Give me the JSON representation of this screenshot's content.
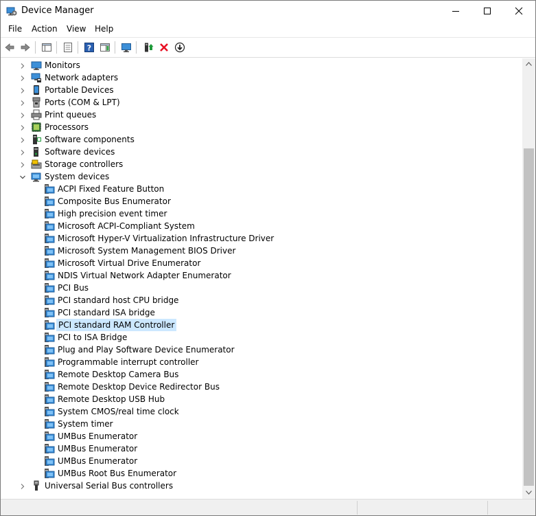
{
  "window": {
    "title": "Device Manager"
  },
  "menu": [
    "File",
    "Action",
    "View",
    "Help"
  ],
  "colors": {
    "selection": "#cce8ff",
    "accent": "#0078d7",
    "delete": "#e81123",
    "green": "#1e9a3a"
  },
  "toolbar_icons": [
    "back-icon",
    "forward-icon",
    "show-hide-tree-icon",
    "properties-icon",
    "help-icon",
    "action-pane-icon",
    "monitor-scan-icon",
    "update-driver-icon",
    "uninstall-icon",
    "download-icon"
  ],
  "tree": [
    {
      "label": "Monitors",
      "level": 0,
      "expanded": false,
      "icon": "monitor"
    },
    {
      "label": "Network adapters",
      "level": 0,
      "expanded": false,
      "icon": "network"
    },
    {
      "label": "Portable Devices",
      "level": 0,
      "expanded": false,
      "icon": "portable"
    },
    {
      "label": "Ports (COM & LPT)",
      "level": 0,
      "expanded": false,
      "icon": "port"
    },
    {
      "label": "Print queues",
      "level": 0,
      "expanded": false,
      "icon": "printer"
    },
    {
      "label": "Processors",
      "level": 0,
      "expanded": false,
      "icon": "chip"
    },
    {
      "label": "Software components",
      "level": 0,
      "expanded": false,
      "icon": "component"
    },
    {
      "label": "Software devices",
      "level": 0,
      "expanded": false,
      "icon": "softdev"
    },
    {
      "label": "Storage controllers",
      "level": 0,
      "expanded": false,
      "icon": "storage"
    },
    {
      "label": "System devices",
      "level": 0,
      "expanded": true,
      "icon": "system"
    },
    {
      "label": "ACPI Fixed Feature Button",
      "level": 1,
      "icon": "sysdev"
    },
    {
      "label": "Composite Bus Enumerator",
      "level": 1,
      "icon": "sysdev"
    },
    {
      "label": "High precision event timer",
      "level": 1,
      "icon": "sysdev"
    },
    {
      "label": "Microsoft ACPI-Compliant System",
      "level": 1,
      "icon": "sysdev"
    },
    {
      "label": "Microsoft Hyper-V Virtualization Infrastructure Driver",
      "level": 1,
      "icon": "sysdev"
    },
    {
      "label": "Microsoft System Management BIOS Driver",
      "level": 1,
      "icon": "sysdev"
    },
    {
      "label": "Microsoft Virtual Drive Enumerator",
      "level": 1,
      "icon": "sysdev"
    },
    {
      "label": "NDIS Virtual Network Adapter Enumerator",
      "level": 1,
      "icon": "sysdev"
    },
    {
      "label": "PCI Bus",
      "level": 1,
      "icon": "sysdev"
    },
    {
      "label": "PCI standard host CPU bridge",
      "level": 1,
      "icon": "sysdev"
    },
    {
      "label": "PCI standard ISA bridge",
      "level": 1,
      "icon": "sysdev"
    },
    {
      "label": "PCI standard RAM Controller",
      "level": 1,
      "icon": "sysdev",
      "selected": true
    },
    {
      "label": "PCI to ISA Bridge",
      "level": 1,
      "icon": "sysdev"
    },
    {
      "label": "Plug and Play Software Device Enumerator",
      "level": 1,
      "icon": "sysdev"
    },
    {
      "label": "Programmable interrupt controller",
      "level": 1,
      "icon": "sysdev"
    },
    {
      "label": "Remote Desktop Camera Bus",
      "level": 1,
      "icon": "sysdev"
    },
    {
      "label": "Remote Desktop Device Redirector Bus",
      "level": 1,
      "icon": "sysdev"
    },
    {
      "label": "Remote Desktop USB Hub",
      "level": 1,
      "icon": "sysdev"
    },
    {
      "label": "System CMOS/real time clock",
      "level": 1,
      "icon": "sysdev"
    },
    {
      "label": "System timer",
      "level": 1,
      "icon": "sysdev"
    },
    {
      "label": "UMBus Enumerator",
      "level": 1,
      "icon": "sysdev"
    },
    {
      "label": "UMBus Enumerator",
      "level": 1,
      "icon": "sysdev"
    },
    {
      "label": "UMBus Enumerator",
      "level": 1,
      "icon": "sysdev"
    },
    {
      "label": "UMBus Root Bus Enumerator",
      "level": 1,
      "icon": "sysdev"
    },
    {
      "label": "Universal Serial Bus controllers",
      "level": 0,
      "expanded": false,
      "icon": "usb"
    }
  ]
}
